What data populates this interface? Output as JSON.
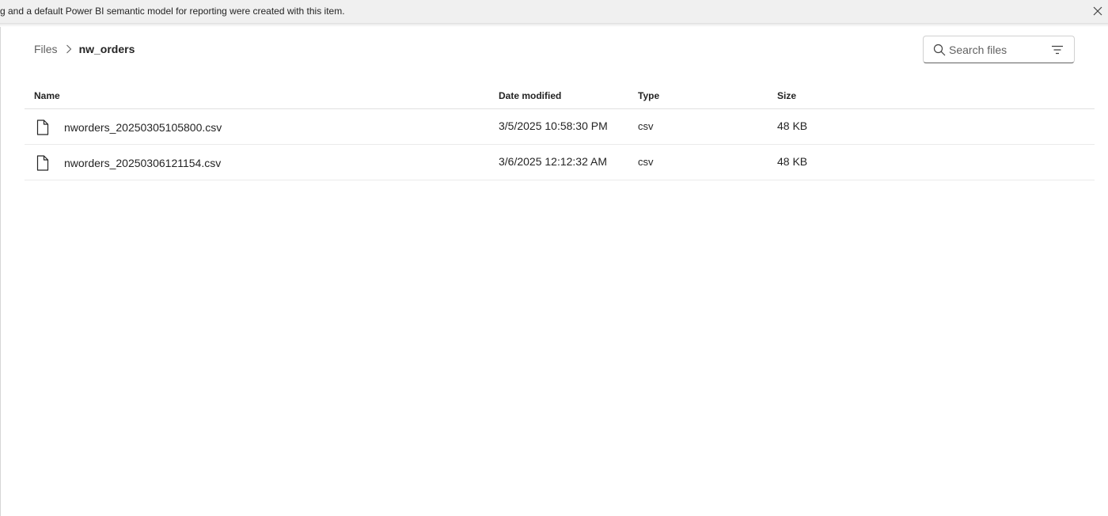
{
  "banner": {
    "message": "g and a default Power BI semantic model for reporting were created with this item.",
    "close_icon": "close-icon"
  },
  "breadcrumb": {
    "root": "Files",
    "current": "nw_orders",
    "separator_icon": "chevron-right-icon"
  },
  "search": {
    "placeholder": "Search files",
    "value": "",
    "icon": "search-icon",
    "filter_icon": "filter-icon"
  },
  "table": {
    "columns": [
      "Name",
      "Date modified",
      "Type",
      "Size"
    ],
    "rows": [
      {
        "icon": "file-icon",
        "name": "nworders_20250305105800.csv",
        "date_modified": "3/5/2025 10:58:30 PM",
        "type": "csv",
        "size": "48 KB"
      },
      {
        "icon": "file-icon",
        "name": "nworders_20250306121154.csv",
        "date_modified": "3/6/2025 12:12:32 AM",
        "type": "csv",
        "size": "48 KB"
      }
    ]
  },
  "colors": {
    "banner_bg": "#f0f0f0",
    "text": "#242424",
    "muted_text": "#616161",
    "divider": "#e0e0e0"
  }
}
